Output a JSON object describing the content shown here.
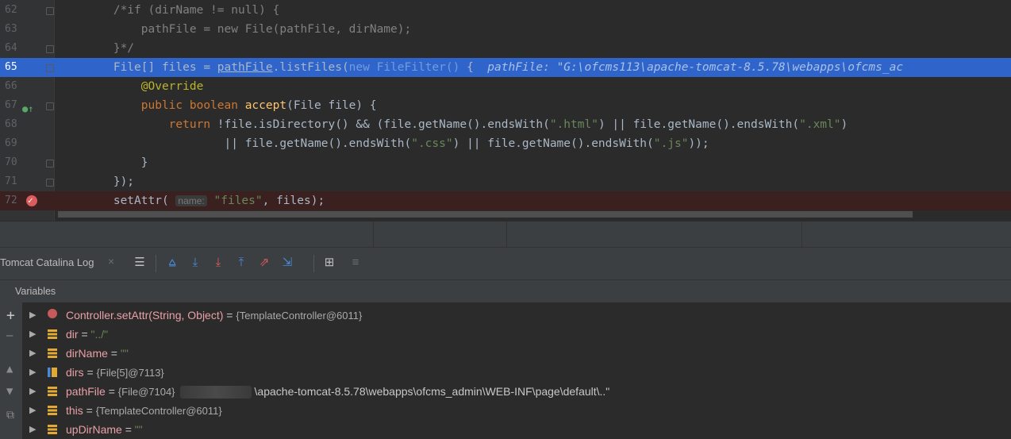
{
  "editor": {
    "lines": [
      {
        "num": "62",
        "segments": [
          {
            "text": "        /*if (dirName != null) {",
            "cls": "cm"
          }
        ]
      },
      {
        "num": "63",
        "segments": [
          {
            "text": "            pathFile = new File(pathFile, dirName);",
            "cls": "cm"
          }
        ]
      },
      {
        "num": "64",
        "segments": [
          {
            "text": "        }*/",
            "cls": "cm"
          }
        ]
      },
      {
        "num": "65",
        "segments": [
          {
            "text": "        File[] files = ",
            "cls": ""
          },
          {
            "text": "pathFile",
            "cls": "ul"
          },
          {
            "text": ".listFiles(",
            "cls": ""
          },
          {
            "text": "new FileFilter()",
            "cls": "dim"
          },
          {
            "text": " {  ",
            "cls": ""
          },
          {
            "text": "pathFile: \"G:\\ofcms113\\apache-tomcat-8.5.78\\webapps\\ofcms_ac",
            "cls": "inlay"
          }
        ]
      },
      {
        "num": "66",
        "segments": [
          {
            "text": "            @Override",
            "cls": "ann"
          }
        ]
      },
      {
        "num": "67",
        "segments": [
          {
            "text": "            public boolean ",
            "cls": "kw"
          },
          {
            "text": "accept",
            "cls": "fn"
          },
          {
            "text": "(File file) {",
            "cls": ""
          }
        ]
      },
      {
        "num": "68",
        "segments": [
          {
            "text": "                return ",
            "cls": "kw"
          },
          {
            "text": "!file.isDirectory() && (file.getName().endsWith(",
            "cls": ""
          },
          {
            "text": "\".html\"",
            "cls": "str"
          },
          {
            "text": ") || file.getName().endsWith(",
            "cls": ""
          },
          {
            "text": "\".xml\"",
            "cls": "str"
          },
          {
            "text": ")",
            "cls": ""
          }
        ]
      },
      {
        "num": "69",
        "segments": [
          {
            "text": "                        || file.getName().endsWith(",
            "cls": ""
          },
          {
            "text": "\".css\"",
            "cls": "str"
          },
          {
            "text": ") || file.getName().endsWith(",
            "cls": ""
          },
          {
            "text": "\".js\"",
            "cls": "str"
          },
          {
            "text": "));",
            "cls": ""
          }
        ]
      },
      {
        "num": "70",
        "segments": [
          {
            "text": "            }",
            "cls": ""
          }
        ]
      },
      {
        "num": "71",
        "segments": [
          {
            "text": "        });",
            "cls": ""
          }
        ]
      },
      {
        "num": "72",
        "segments": [
          {
            "text": "        setAttr( ",
            "cls": ""
          },
          {
            "text": "name:",
            "cls": "hint"
          },
          {
            "text": " ",
            "cls": ""
          },
          {
            "text": "\"files\"",
            "cls": "str"
          },
          {
            "text": ", files);",
            "cls": ""
          }
        ]
      }
    ]
  },
  "toolbar": {
    "tab_title": "Tomcat Catalina Log",
    "close_glyph": "×",
    "buttons": [
      {
        "name": "hamburger-menu-icon",
        "glyph": "☰"
      },
      {
        "name": "show-execution-point-icon",
        "glyph": "⩠"
      },
      {
        "name": "step-over-icon",
        "glyph": "⤓"
      },
      {
        "name": "step-into-icon",
        "glyph": "⤓"
      },
      {
        "name": "step-out-icon",
        "glyph": "⤒"
      },
      {
        "name": "force-step-icon",
        "glyph": "⇗"
      },
      {
        "name": "run-to-cursor-icon",
        "glyph": "⇲"
      },
      {
        "name": "evaluate-icon",
        "glyph": "⊞"
      },
      {
        "name": "trace-icon",
        "glyph": "≡"
      }
    ]
  },
  "variables": {
    "header": "Variables",
    "rows": [
      {
        "icon": "method-icon",
        "name": "Controller.setAttr(String, Object)",
        "eq": " = ",
        "value": "{TemplateController@6011}",
        "value_cls": "vval"
      },
      {
        "icon": "field-icon",
        "name": "dir",
        "eq": " = ",
        "value": "\"../\"",
        "value_cls": "vstr"
      },
      {
        "icon": "field-icon",
        "name": "dirName",
        "eq": " = ",
        "value": "\"\"",
        "value_cls": "vstr"
      },
      {
        "icon": "list-icon",
        "name": "dirs",
        "eq": " = ",
        "value": "{File[5]@7113}",
        "value_cls": "vval"
      },
      {
        "icon": "field-icon",
        "name": "pathFile",
        "eq": " = ",
        "value": "{File@7104}",
        "value_cls": "vval",
        "redacted": true,
        "tail": "\\apache-tomcat-8.5.78\\webapps\\ofcms_admin\\WEB-INF\\page\\default\\..\""
      },
      {
        "icon": "field-icon",
        "name": "this",
        "eq": " = ",
        "value": "{TemplateController@6011}",
        "value_cls": "vval"
      },
      {
        "icon": "field-icon",
        "name": "upDirName",
        "eq": " = ",
        "value": "\"\"",
        "value_cls": "vstr"
      }
    ]
  },
  "side": [
    "+",
    "—",
    "▲",
    "▼",
    "⧉"
  ]
}
